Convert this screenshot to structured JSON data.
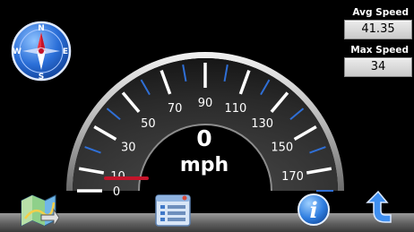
{
  "gauge": {
    "scale_labels": [
      "0",
      "10",
      "30",
      "50",
      "70",
      "90",
      "110",
      "130",
      "150",
      "170"
    ],
    "current_speed": "0",
    "unit": "mph",
    "needle_color": "#c4142a",
    "tick_color_major": "#ffffff",
    "tick_color_minor": "#2f6fd6"
  },
  "stats": {
    "avg_speed_label": "Avg Speed",
    "avg_speed_value": "41.35",
    "max_speed_label": "Max Speed",
    "max_speed_value": "34"
  },
  "compass": {
    "icon": "compass-icon",
    "north": "N",
    "south": "S",
    "east": "E",
    "west": "W"
  },
  "toolbar": {
    "map_icon": "map-icon",
    "list_icon": "list-icon",
    "info_icon": "info-icon",
    "info_glyph": "i",
    "back_icon": "back-arrow-icon"
  },
  "colors": {
    "background": "#000000",
    "accent_blue": "#2f6fd6",
    "needle_red": "#c4142a"
  }
}
